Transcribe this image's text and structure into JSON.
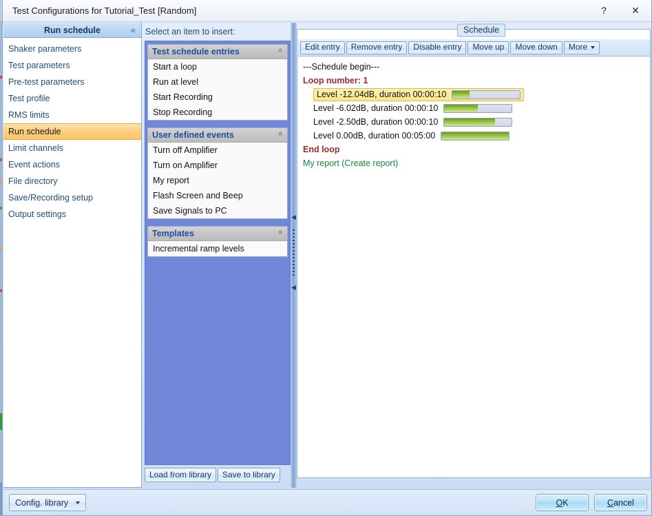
{
  "window": {
    "title": "Test Configurations for Tutorial_Test [Random]",
    "help_label": "?",
    "close_label": "✕"
  },
  "sidebar": {
    "header": "Run schedule",
    "collapse_icon": "«",
    "items": [
      {
        "label": "Shaker parameters"
      },
      {
        "label": "Test parameters"
      },
      {
        "label": "Pre-test parameters"
      },
      {
        "label": "Test profile"
      },
      {
        "label": "RMS limits"
      },
      {
        "label": "Run schedule"
      },
      {
        "label": "Limit channels"
      },
      {
        "label": "Event actions"
      },
      {
        "label": "File directory"
      },
      {
        "label": "Save/Recording setup"
      },
      {
        "label": "Output settings"
      }
    ],
    "selected_index": 5
  },
  "insert_panel": {
    "label": "Select an item to insert:",
    "chevron_icon": "«",
    "groups": [
      {
        "title": "Test schedule entries",
        "items": [
          {
            "label": "Start a loop"
          },
          {
            "label": "Run at level"
          },
          {
            "label": "Start Recording"
          },
          {
            "label": "Stop Recording"
          }
        ]
      },
      {
        "title": "User defined events",
        "items": [
          {
            "label": "Turn off Amplifier"
          },
          {
            "label": "Turn on Amplifier"
          },
          {
            "label": "My report"
          },
          {
            "label": "Flash Screen and Beep"
          },
          {
            "label": "Save Signals to PC"
          }
        ]
      },
      {
        "title": "Templates",
        "items": [
          {
            "label": "Incremental ramp levels"
          }
        ]
      }
    ],
    "load_button": "Load from library",
    "save_button": "Save to library"
  },
  "schedule": {
    "legend": "Schedule",
    "toolbar": [
      {
        "label": "Edit entry",
        "has_caret": false
      },
      {
        "label": "Remove entry",
        "has_caret": false
      },
      {
        "label": "Disable entry",
        "has_caret": false
      },
      {
        "label": "Move up",
        "has_caret": false
      },
      {
        "label": "Move down",
        "has_caret": false
      },
      {
        "label": "More",
        "has_caret": true
      }
    ],
    "rows": [
      {
        "kind": "plain",
        "text": "---Schedule begin---"
      },
      {
        "kind": "loop",
        "text": "Loop number: 1"
      },
      {
        "kind": "entry",
        "text": "Level -12.04dB, duration 00:00:10",
        "fill_percent": 25,
        "selected": true
      },
      {
        "kind": "entry",
        "text": "Level -6.02dB, duration 00:00:10",
        "fill_percent": 50,
        "selected": false
      },
      {
        "kind": "entry",
        "text": "Level -2.50dB, duration 00:00:10",
        "fill_percent": 75,
        "selected": false
      },
      {
        "kind": "entry",
        "text": "Level 0.00dB, duration 00:05:00",
        "fill_percent": 100,
        "selected": false
      },
      {
        "kind": "loop",
        "text": "End loop"
      },
      {
        "kind": "event",
        "text": "My report (Create report)"
      }
    ]
  },
  "footer": {
    "config_library": "Config. library",
    "ok": {
      "pre": "",
      "accel": "O",
      "post": "K"
    },
    "cancel": {
      "pre": "",
      "accel": "C",
      "post": "ancel"
    }
  },
  "colors": {
    "accent_blue": "#1f4e79",
    "selection_orange": "#fdcf7e",
    "loop_red": "#9e2a2a",
    "event_green": "#118a3c",
    "panel_blue": "#7188d8",
    "bar_green": "#8cbb36"
  }
}
